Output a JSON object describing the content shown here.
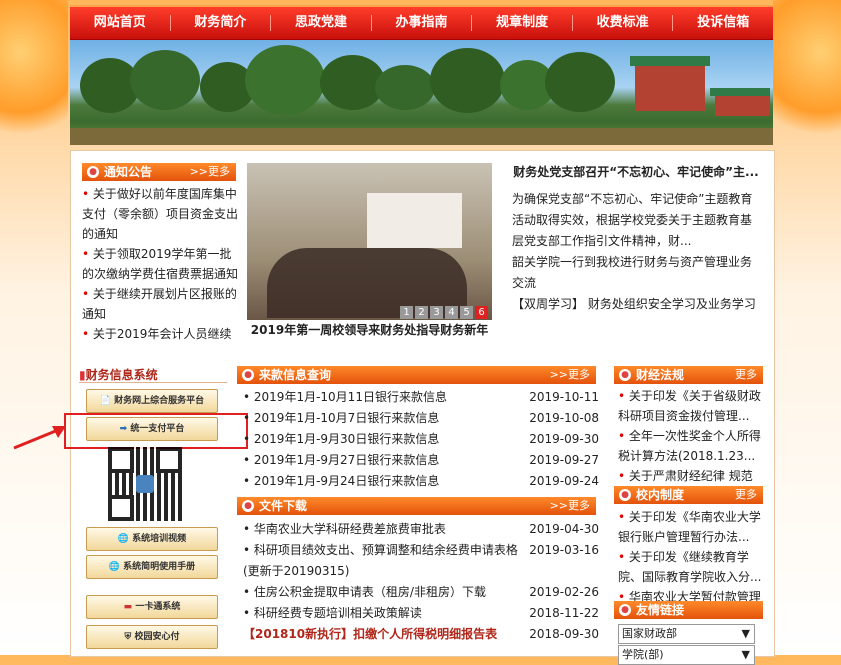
{
  "nav": [
    "网站首页",
    "财务简介",
    "思政党建",
    "办事指南",
    "规章制度",
    "收费标准",
    "投诉信箱"
  ],
  "notice": {
    "title": "通知公告",
    "more": ">>更多",
    "items": [
      "关于做好以前年度国库集中支付（零余额）项目资金支出的通知",
      "关于领取2019学年第一批的次缴纳学费住宿费票据通知",
      "关于继续开展划片区报账的通知",
      "关于2019年会计人员继续"
    ]
  },
  "slide": {
    "caption": "2019年第一周校领导来财务处指导财务新年",
    "pages": [
      "1",
      "2",
      "3",
      "4",
      "5",
      "6"
    ],
    "active_page": "6"
  },
  "feature": {
    "headline": "财务处党支部召开“不忘初心、牢记使命”主...",
    "para1": "为确保党支部“不忘初心、牢记使命”主题教育活动取得实效，根据学校党委关于主题教育基层党支部工作指引文件精神，财...",
    "para2": "韶关学院一行到我校进行财务与资产管理业务交流",
    "para3": "【双周学习】 财务处组织安全学习及业务学习"
  },
  "sidebar": {
    "title": "财务信息系统",
    "buttons": [
      "财务网上综合服务平台",
      "统一支付平台",
      "系统培训视频",
      "系统简明使用手册",
      "一卡通系统",
      "校园安心付"
    ]
  },
  "funds": {
    "title": "来款信息查询",
    "more": ">>更多",
    "rows": [
      {
        "text": "2019年1月-10月11日银行来款信息",
        "date": "2019-10-11"
      },
      {
        "text": "2019年1月-10月7日银行来款信息",
        "date": "2019-10-08"
      },
      {
        "text": "2019年1月-9月30日银行来款信息",
        "date": "2019-09-30"
      },
      {
        "text": "2019年1月-9月27日银行来款信息",
        "date": "2019-09-27"
      },
      {
        "text": "2019年1月-9月24日银行来款信息",
        "date": "2019-09-24"
      }
    ]
  },
  "files": {
    "title": "文件下载",
    "more": ">>更多",
    "rows": [
      {
        "text": "华南农业大学科研经费差旅费审批表",
        "date": "2019-04-30"
      },
      {
        "text": "科研项目绩效支出、预算调整和结余经费申请表格(更新于20190315)",
        "date": "2019-03-16"
      },
      {
        "text": "住房公积金提取申请表（租房/非租房）下载",
        "date": "2019-02-26"
      },
      {
        "text": "科研经费专题培训相关政策解读",
        "date": "2018-11-22"
      },
      {
        "text": "【201810新执行】扣缴个人所得税明细报告表",
        "date": "2018-09-30"
      }
    ]
  },
  "laws": {
    "title": "财经法规",
    "more": "更多",
    "items": [
      "关于印发《关于省级财政科研项目资金拨付管理...",
      "全年一次性奖金个人所得税计算方法(2018.1.23...",
      "关于严肃财经纪律 规范国有资产管理的通知"
    ]
  },
  "rules": {
    "title": "校内制度",
    "more": "更多",
    "items": [
      "关于印发《华南农业大学银行账户管理暂行办法...",
      "关于印发《继续教育学院、国际教育学院收入分...",
      "华南农业大学暂付款管理办法"
    ]
  },
  "links": {
    "title": "友情链接",
    "options": [
      "国家财政部",
      "学院(部)"
    ]
  }
}
